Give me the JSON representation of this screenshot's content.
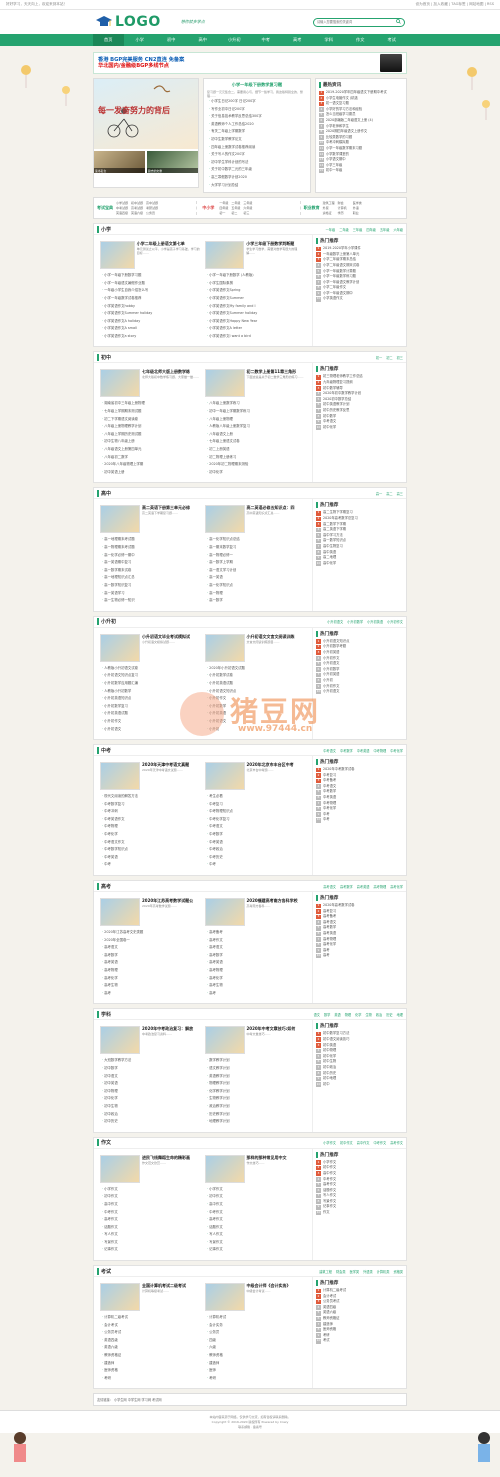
{
  "topbar": {
    "left": "好好学习，天天向上，欢迎来到本站！",
    "right": "设为首页 | 加入收藏 | TAG标签 | 网站地图 | RSS"
  },
  "header": {
    "logo_text": "LOGO",
    "slogan": "想你就多学点",
    "search_placeholder": "请输入您要搜索的关键词"
  },
  "nav": [
    "首页",
    "小学",
    "初中",
    "高中",
    "小升初",
    "中考",
    "高考",
    "学科",
    "作文",
    "考试"
  ],
  "banner": {
    "line1": "香港 BGP完美服务 CN2直连 免备案",
    "line2": "华北国内/金融级BGP多线节点"
  },
  "slider": {
    "caption": "每一发奋努力的背后",
    "thumb1": "读书名言",
    "thumb2": "励志的文章"
  },
  "mid_news": {
    "title": "小学一年级下册数学复习题",
    "desc": "复习题一元元集合二，需要用心与，细节一些学习，我这版特别全的、整理……",
    "items": [
      "小学生日记200字 日记200字",
      "写作业初中日记200字",
      "关于信息技术教学反思总结300字",
      "英语教师个人工作总结2020",
      "有关二年级上学期数学",
      "初中生数学教学论文",
      "四年级上册数学试卷推荐阅读",
      "关于写人的作文200字",
      "初中学生学科计划的写法",
      "关于初中数学二元的三年级",
      "高三寒假数学计划2020",
      "大学学习计划总结"
    ]
  },
  "latest": {
    "title": "最热资讯",
    "items": [
      "2019-2020学年四年级语文下册期中考试",
      "小学生电脑作文 (精选",
      "初一语文复习题",
      "小学好的学习方法和经验",
      "怎么当班级学习委员",
      "2020部编版二年级语文上册 (4)",
      "小学老师和学生",
      "2020期四年级语文上册作文",
      "比较类数学的习题",
      "中考冲刺模拟题",
      "小学一年级数学期末习题",
      "小学数学课堂的",
      "小学语文期中",
      "小学三年级",
      "初中一年级"
    ]
  },
  "catbar": [
    {
      "name": "考试宝典",
      "links": [
        "小学试题",
        "初中试题",
        "高中试题",
        "中考试题",
        "高考试题",
        "考研试题",
        "英语四级",
        "英语六级",
        "公务员"
      ]
    },
    {
      "name": "中小学",
      "links": [
        "一年级",
        "二年级",
        "三年级",
        "四年级",
        "五年级",
        "六年级",
        "初一",
        "初二",
        "初三"
      ]
    },
    {
      "name": "职业教育",
      "links": [
        "建筑工程",
        "财会",
        "医学类",
        "外贸",
        "计算机",
        "外语",
        "资格证",
        "学历",
        "职业"
      ]
    }
  ],
  "sections": [
    {
      "title": "小学",
      "key": "xiaoxue",
      "subtabs": [
        "一年级",
        "二年级",
        "三年级",
        "四年级",
        "五年级",
        "六年级"
      ],
      "feat": [
        {
          "title": "小学二年级上册语文第七单",
          "desc": "单元测试之以平，小学是孩子学习基础，学习的目标……"
        },
        {
          "title": "小学三年级下册数学判断题",
          "desc": "学生学习数学，需要对数学有很大的理解……"
        }
      ],
      "left": [
        "小学一年级下册数学习题",
        "小学一年级语文暑假作业题",
        "一年级小学生自我介绍怎么写",
        "小学一年级数学试卷推荐",
        "小学英语作文hobby",
        "小学英语作文Summer holiday",
        "小学英语作文A holiday",
        "小学英语作文A small",
        "小学英语作文a story"
      ],
      "right": [
        "小学一年级下册数学 (人教版)",
        "小学生国际象棋",
        "小学英语作文Spring",
        "小学英语作文Summer",
        "小学英语作文My family and I",
        "小学英语作文Summer holiday",
        "小学英语作文Happy New Year",
        "小学英语作文A letter",
        "小学英语作文I want a bird"
      ],
      "hot": [
        "2019-2020学年小学课件",
        "一年级数学上册第八单元",
        "小学二年级学期末总结",
        "小学二年级语文期末试卷",
        "小学一年级数学计算题",
        "小学一年级数学练习题",
        "小学一年级语文教学计划",
        "小学二年级作文",
        "小学一年级语文期中",
        "小学英语作文"
      ]
    },
    {
      "title": "初中",
      "key": "chuzhong",
      "subtabs": [
        "初一",
        "初二",
        "初三"
      ],
      "feat": [
        {
          "title": "七年级北师大版上册数学练",
          "desc": "北师大版初中数学练习题，大家做一做……"
        },
        {
          "title": "初二数学上册第11章三角形",
          "desc": "下面这些是关于初二数学三角形的练习……"
        }
      ],
      "left": [
        "湖南省初中三年级上册物理",
        "七年级上学期期末测试题",
        "初二下学期语文阅读卷",
        "八年级上册物理教学计划",
        "八年级上学期历史测试题",
        "初中生物八年级上册",
        "八年级语文上册第四单元",
        "八年级初二数学",
        "2020年八年级物理上学期",
        "初中英语上册"
      ],
      "right": [
        "八年级上册数学练习",
        "初中一年级上学期数学练习",
        "八年级上册物理",
        "人教版八年级上册数学复习",
        "八年级语文上册",
        "七年级上册语文试卷",
        "初二上册英语",
        "初二物理上册练习",
        "2020年初二物理期末测验",
        "初中化学"
      ],
      "hot": [
        "初三物理老师教学工作总结",
        "九年级物理复习提纲",
        "初中数学辅导",
        "2020年初中数学教学计划",
        "2020初中数学总结",
        "初中英语教学计划",
        "初中历史教学反思",
        "初中数学",
        "中考语文",
        "初中化学"
      ]
    },
    {
      "title": "高中",
      "key": "gaozhong",
      "subtabs": [
        "高一",
        "高二",
        "高三"
      ],
      "feat": [
        {
          "title": "高二英语下册第三单元必修",
          "desc": "高二英语下学期复习题……"
        },
        {
          "title": "高二英语必修五知识点：四",
          "desc": "高中英语知识点汇总……"
        }
      ],
      "left": [
        "高一地理期末考试题",
        "高一物理期末考试题",
        "高一化学必修一期中",
        "高一英语期中复习",
        "高一数学期末试卷",
        "高一地理知识点汇总",
        "高一数学知识复习",
        "高一英语学习",
        "高一生物必修一知识"
      ],
      "right": [
        "高一化学知识点总结",
        "高一期末数学复习",
        "高一物理必修一",
        "高一数学上学期",
        "高一语文学习计划",
        "高一英语",
        "高一化学知识点",
        "高一物理",
        "高一数学"
      ],
      "hot": [
        "高二生物下学期复习",
        "2020年高考数学总复习",
        "高二数学下学期",
        "高二英语下学期",
        "高中学习方法",
        "高一数学知识点",
        "高中生物复习",
        "高中英语",
        "高二地理",
        "高中化学"
      ]
    },
    {
      "title": "小升初",
      "key": "xiaoshengchu",
      "subtabs": [
        "小升初语文",
        "小升初数学",
        "小升初英语",
        "小升初作文"
      ],
      "feat": [
        {
          "title": "小升初语文毕业考试模拟试",
          "desc": "小升初语文模拟试题……"
        },
        {
          "title": "小升初语文文言文阅读训练",
          "desc": "文言文阅读训练题目……"
        }
      ],
      "left": [
        "人教版小升初语文试卷",
        "小升初语文知识点复习",
        "小升初数学应用题汇编",
        "人教版小升初数学",
        "小升初英语知识点",
        "小升初数学复习",
        "小升初英语试题",
        "小升初作文",
        "小升初语文"
      ],
      "right": [
        "2020年小升初语文试题",
        "小升初数学试卷",
        "小升初英语试题",
        "小升初语文知识点",
        "小升初作文",
        "小升初数学",
        "小升初英语",
        "小升初语文",
        "小升初"
      ],
      "hot": [
        "小升初语文知识点",
        "小升初数学考题",
        "小升初英语",
        "小升初作文",
        "小升初语文",
        "小升初数学",
        "小升初英语",
        "小升初",
        "小升初作文",
        "小升初语文"
      ]
    },
    {
      "title": "中考",
      "key": "zhongkao",
      "subtabs": [
        "中考语文",
        "中考数学",
        "中考英语",
        "中考物理",
        "中考化学"
      ],
      "feat": [
        {
          "title": "2020年天津中考语文真题",
          "desc": "2020年天津中考语文试题……"
        },
        {
          "title": "2020年北京市丰台区中考",
          "desc": "北京丰台中考题……"
        }
      ],
      "left": [
        "现代文阅读的解答方法",
        "中考数学复习",
        "中考冲刺",
        "中考英语作文",
        "中考物理",
        "中考化学",
        "中考语文作文",
        "中考数学知识点",
        "中考英语",
        "中考"
      ],
      "right": [
        "考生必看",
        "中考复习",
        "中考物理知识点",
        "中考化学复习",
        "中考语文",
        "中考数学",
        "中考英语",
        "中考政治",
        "中考历史",
        "中考"
      ],
      "hot": [
        "2020年中考数学试卷",
        "中考复习",
        "中考备考",
        "中考语文",
        "中考数学",
        "中考英语",
        "中考物理",
        "中考化学",
        "中考",
        "中考"
      ]
    },
    {
      "title": "高考",
      "key": "gaokao",
      "subtabs": [
        "高考语文",
        "高考数学",
        "高考英语",
        "高考物理",
        "高考化学"
      ],
      "feat": [
        {
          "title": "2020年江苏高考数学试题公",
          "desc": "2020年高考数学试题……"
        },
        {
          "title": "2020福建高考南方各科学校",
          "desc": "高考南方各科……"
        }
      ],
      "left": [
        "2020年江苏高考文史类题",
        "2020年全国卷一",
        "高考语文",
        "高考数学",
        "高考英语",
        "高考物理",
        "高考化学",
        "高考生物",
        "高考"
      ],
      "right": [
        "高考备考",
        "高考作文",
        "高考语文",
        "高考数学",
        "高考英语",
        "高考物理",
        "高考化学",
        "高考生物",
        "高考"
      ],
      "hot": [
        "2020年高考数学试卷",
        "高考复习",
        "高考备考",
        "高考语文",
        "高考数学",
        "高考英语",
        "高考物理",
        "高考化学",
        "高考",
        "高考"
      ]
    },
    {
      "title": "学科",
      "key": "xueke",
      "subtabs": [
        "语文",
        "数学",
        "英语",
        "物理",
        "化学",
        "生物",
        "政治",
        "历史",
        "地理"
      ],
      "feat": [
        {
          "title": "2020年中考政治复习：解放",
          "desc": "中考政治复习资料……"
        },
        {
          "title": "2020年中考文章技巧:如何",
          "desc": "中考文章技巧……"
        }
      ],
      "left": [
        "大班数学教学方法",
        "初中数学",
        "初中语文",
        "初中英语",
        "初中物理",
        "初中化学",
        "初中生物",
        "初中政治",
        "初中历史"
      ],
      "right": [
        "数学教学计划",
        "语文教学计划",
        "英语教学计划",
        "物理教学计划",
        "化学教学计划",
        "生物教学计划",
        "政治教学计划",
        "历史教学计划",
        "地理教学计划"
      ],
      "hot": [
        "初中数学复习方法",
        "初中语文阅读技巧",
        "初中英语",
        "初中物理",
        "初中化学",
        "初中生物",
        "初中政治",
        "初中历史",
        "初中地理",
        "初中"
      ]
    },
    {
      "title": "作文",
      "key": "zuowen",
      "subtabs": [
        "小学作文",
        "初中作文",
        "高中作文",
        "中考作文",
        "高考作文"
      ],
      "feat": [
        {
          "title": "进民飞线舞蹈生命的精彩画",
          "desc": "作文范文欣赏……"
        },
        {
          "title": "那样的那种常见用中文",
          "desc": "作文技巧……"
        }
      ],
      "left": [
        "小学作文",
        "初中作文",
        "高中作文",
        "中考作文",
        "高考作文",
        "话题作文",
        "写人作文",
        "写景作文",
        "记事作文"
      ],
      "right": [
        "小学作文",
        "初中作文",
        "高中作文",
        "中考作文",
        "高考作文",
        "话题作文",
        "写人作文",
        "写景作文",
        "记事作文"
      ],
      "hot": [
        "小学作文",
        "初中作文",
        "高中作文",
        "中考作文",
        "高考作文",
        "话题作文",
        "写人作文",
        "写景作文",
        "记事作文",
        "作文"
      ]
    },
    {
      "title": "考试",
      "key": "kaoshi",
      "subtabs": [
        "建筑工程",
        "财会类",
        "医学类",
        "外语类",
        "计算机类",
        "资格类"
      ],
      "feat": [
        {
          "title": "全国计算机考试二级考试",
          "desc": "计算机等级考试……"
        },
        {
          "title": "中级会计师《会计实务》",
          "desc": "中级会计考试……"
        }
      ],
      "left": [
        "计算机二级考试",
        "会计考试",
        "公务员考试",
        "英语四级",
        "英语六级",
        "教师资格证",
        "建造师",
        "医师资格",
        "考研"
      ],
      "right": [
        "计算机考试",
        "会计实务",
        "公务员",
        "四级",
        "六级",
        "教师资格",
        "建造师",
        "医师",
        "考研"
      ],
      "hot": [
        "计算机二级考试",
        "会计考试",
        "公务员考试",
        "英语四级",
        "英语六级",
        "教师资格证",
        "建造师",
        "医师资格",
        "考研",
        "考试"
      ]
    }
  ],
  "common": {
    "hot_title": "热门推荐",
    "more": "更多 >"
  },
  "friend": {
    "label": "友情链接：",
    "links": "小学生网  中学生网  学习网  考试网"
  },
  "footer": {
    "line1": "本站内容来源于网络，仅供学习交流，如有侵权请联系删除。",
    "line2": "Copyright © 2016-2020 版权所有 Powered by Crazy",
    "line3": "联系邮箱 · 备案号"
  },
  "watermark": {
    "text": "猪豆网",
    "url": "www.97444.cn"
  },
  "colors": {
    "brand": "#25a36f",
    "hot": "#e05a3a"
  }
}
